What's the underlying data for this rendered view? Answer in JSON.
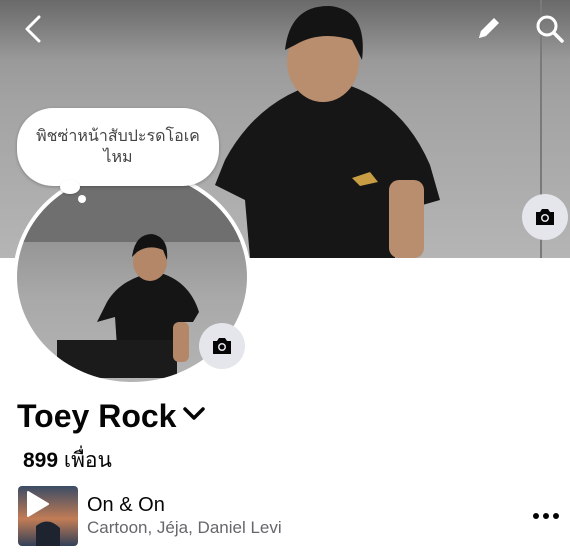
{
  "cover": {
    "nav": {
      "back": "back-icon",
      "edit": "pencil-icon",
      "search": "search-icon"
    },
    "camera_icon": "camera-icon"
  },
  "note": {
    "text": "พิชซ่าหน้าสับปะรดโอเค ไหม"
  },
  "avatar": {
    "camera_icon": "camera-icon"
  },
  "profile": {
    "name": "Toey Rock",
    "friends_count": "899",
    "friends_label": "เพื่อน"
  },
  "music": {
    "title": "On & On",
    "artists": "Cartoon, Jéja, Daniel Levi"
  },
  "colors": {
    "button_bg": "#e4e6eb",
    "text": "#050505",
    "secondary_text": "#65676b"
  }
}
